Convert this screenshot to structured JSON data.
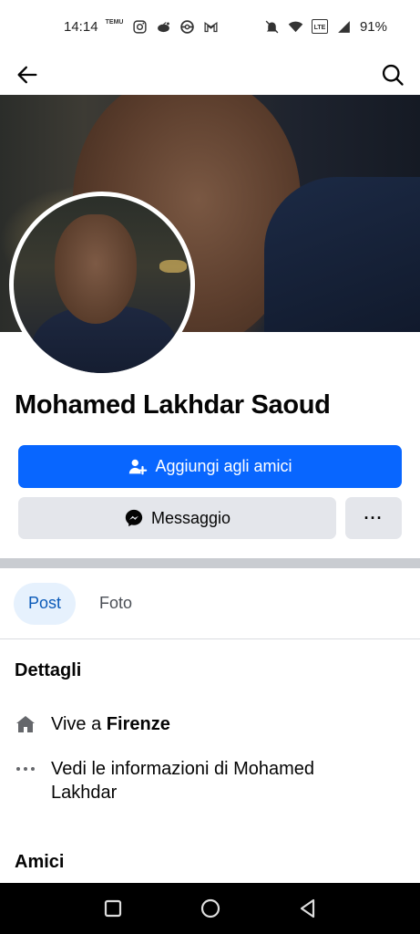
{
  "status_bar": {
    "time": "14:14",
    "temu_label": "TEMU",
    "battery": "91%",
    "icons": [
      "temu-icon",
      "instagram-icon",
      "reddit-icon",
      "pokeball-icon",
      "gmail-icon",
      "mute-icon",
      "wifi-icon",
      "volte-icon",
      "signal-icon"
    ],
    "volte_label": "LTE"
  },
  "app_bar": {
    "back_icon": "arrow-left-icon",
    "search_icon": "search-icon"
  },
  "profile": {
    "name": "Mohamed Lakhdar Saoud"
  },
  "actions": {
    "add_friend_label": "Aggiungi agli amici",
    "message_label": "Messaggio",
    "more_label": "···"
  },
  "tabs": [
    {
      "label": "Post",
      "active": true
    },
    {
      "label": "Foto",
      "active": false
    }
  ],
  "details": {
    "title": "Dettagli",
    "lives_prefix": "Vive a",
    "lives_city": "Firenze",
    "info_line1": "Vedi le informazioni di Mohamed",
    "info_line2": "Lakhdar"
  },
  "friends": {
    "title": "Amici"
  },
  "colors": {
    "primary": "#0866ff",
    "secondary_button": "#e4e6eb",
    "active_tab_bg": "#e6f1fd",
    "active_tab_text": "#0b5ab8"
  }
}
